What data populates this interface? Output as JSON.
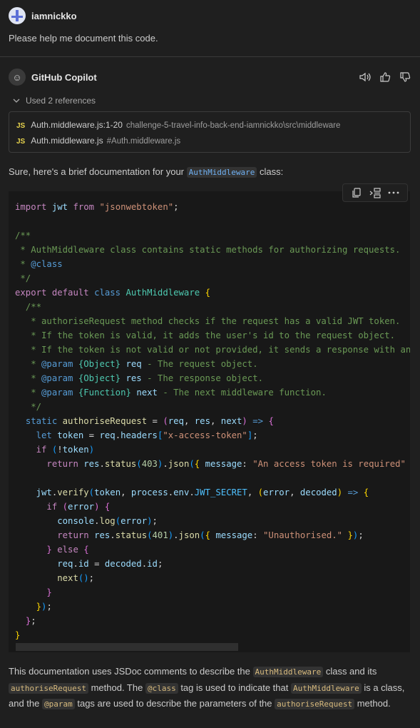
{
  "user": {
    "name": "iamnickko",
    "prompt": "Please help me document this code."
  },
  "copilot": {
    "name": "GitHub Copilot",
    "actions": [
      "speaker-icon",
      "thumbs-up-icon",
      "thumbs-down-icon"
    ],
    "references_toggle": "Used 2 references",
    "references": [
      {
        "badge": "JS",
        "name": "Auth.middleware.js:1-20",
        "path": "challenge-5-travel-info-back-end-iamnickko\\src\\middleware"
      },
      {
        "badge": "JS",
        "name": "Auth.middleware.js",
        "path": "#Auth.middleware.js"
      }
    ],
    "intro": {
      "before": "Sure, here's a brief documentation for your ",
      "code": "AuthMiddleware",
      "after": " class:"
    },
    "outro": {
      "t1": "This documentation uses JSDoc comments to describe the ",
      "c1": "AuthMiddleware",
      "t2": " class and its ",
      "c2": "authoriseRequest",
      "t3": " method. The ",
      "c3": "@class",
      "t4": " tag is used to indicate that ",
      "c4": "AuthMiddleware",
      "t5": " is a class, and the ",
      "c5": "@param",
      "t6": " tags are used to describe the parameters of the ",
      "c6": "authoriseRequest",
      "t7": " method."
    }
  },
  "code_toolbar": [
    "copy-icon",
    "insert-icon",
    "more-icon"
  ],
  "accent": {
    "link_code": "#6fb0f2",
    "js_badge": "#e8d44d"
  }
}
